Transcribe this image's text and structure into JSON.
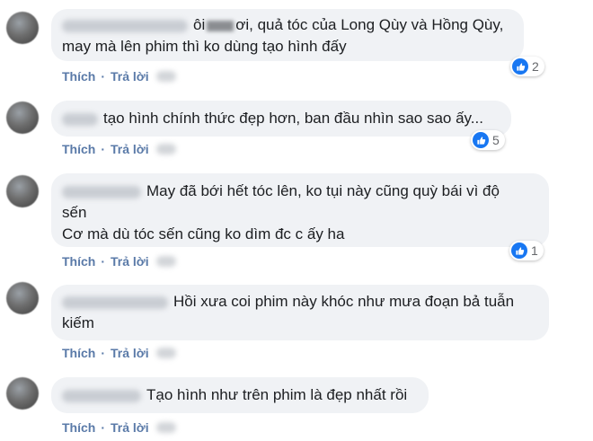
{
  "actions": {
    "like": "Thích",
    "reply": "Trả lời",
    "separator": "·"
  },
  "comments": [
    {
      "text_a": "ôi",
      "text_b": "ơi, quả tóc của Long Qùy và Hồng Qùy,",
      "text_line2": "may mà lên phim thì ko dùng tạo hình đấy",
      "reactions": "2"
    },
    {
      "text": "tạo hình chính thức đẹp hơn, ban đầu nhìn sao sao ấy...",
      "reactions": "5"
    },
    {
      "text_line1": "May đã bới hết tóc lên, ko tụi này cũng quỳ bái vì độ",
      "text_line2": "sến",
      "text_line3": "Cơ mà dù tóc sến cũng ko dìm đc c ấy ha",
      "reactions": "1"
    },
    {
      "text_line1": "Hồi xưa coi phim này khóc như mưa đoạn bả tuẫn",
      "text_line2": "kiếm"
    },
    {
      "text": "Tạo hình như trên phim là đẹp nhất rồi"
    }
  ],
  "icons": {
    "reaction": "like-thumb-icon",
    "avatar": "user-avatar"
  },
  "colors": {
    "bubble": "#f0f2f5",
    "action": "#5a7aa8",
    "like": "#1877f2"
  }
}
